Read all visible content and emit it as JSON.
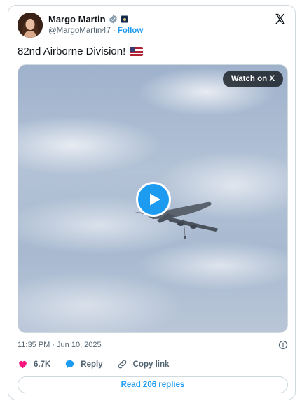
{
  "author": {
    "display_name": "Margo Martin",
    "handle": "@MargoMartin47",
    "separator": "·",
    "follow_label": "Follow"
  },
  "tweet": {
    "text": "82nd Airborne Division!",
    "timestamp": "11:35 PM · Jun 10, 2025"
  },
  "media": {
    "watch_label": "Watch on X"
  },
  "actions": {
    "likes_count": "6.7K",
    "reply_label": "Reply",
    "copy_link_label": "Copy link"
  },
  "replies": {
    "read_label": "Read 206 replies"
  },
  "colors": {
    "accent": "#1d9bf0",
    "like": "#f91880",
    "text_secondary": "#536471"
  },
  "icons": [
    "verified-badge-icon",
    "affiliation-badge-icon",
    "x-logo-icon",
    "us-flag-icon",
    "play-icon",
    "info-icon",
    "heart-icon",
    "reply-icon",
    "link-icon"
  ]
}
